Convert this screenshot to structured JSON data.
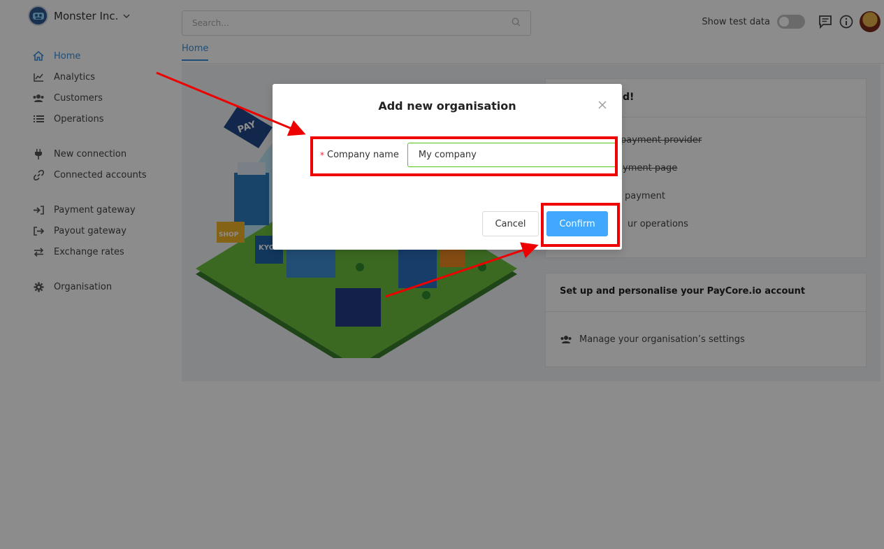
{
  "org": {
    "name": "Monster Inc."
  },
  "sidebar": {
    "items": [
      {
        "label": "Home",
        "icon": "home-icon",
        "active": true
      },
      {
        "label": "Analytics",
        "icon": "chart-line-icon"
      },
      {
        "label": "Customers",
        "icon": "users-icon"
      },
      {
        "label": "Operations",
        "icon": "list-icon"
      },
      {
        "label": "New connection",
        "icon": "plug-icon"
      },
      {
        "label": "Connected accounts",
        "icon": "link-icon"
      },
      {
        "label": "Payment gateway",
        "icon": "sign-in-icon"
      },
      {
        "label": "Payout gateway",
        "icon": "sign-out-icon"
      },
      {
        "label": "Exchange rates",
        "icon": "exchange-icon"
      },
      {
        "label": "Organisation",
        "icon": "gear-icon"
      }
    ]
  },
  "topbar": {
    "search_placeholder": "Search...",
    "test_data_label": "Show test data",
    "test_data_on": false
  },
  "tabs": [
    {
      "label": "Home"
    }
  ],
  "card_get_started": {
    "title_fragment": "d!",
    "items": [
      {
        "text": "payment provider",
        "done": true
      },
      {
        "text": "yment page",
        "done": true
      },
      {
        "text": "payment",
        "done": false
      },
      {
        "text": "ur operations",
        "done": false
      }
    ]
  },
  "card_personalise": {
    "title": "Set up and personalise your PayCore.io account",
    "item": "Manage your organisation’s settings"
  },
  "modal": {
    "title": "Add new organisation",
    "required_mark": "*",
    "field_label": "Company name",
    "field_value": "My company",
    "cancel_label": "Cancel",
    "confirm_label": "Confirm"
  },
  "colors": {
    "accent": "#3b8fdb",
    "confirm": "#40a9ff",
    "valid_border": "#52c41a",
    "annotation": "#ee0000"
  }
}
